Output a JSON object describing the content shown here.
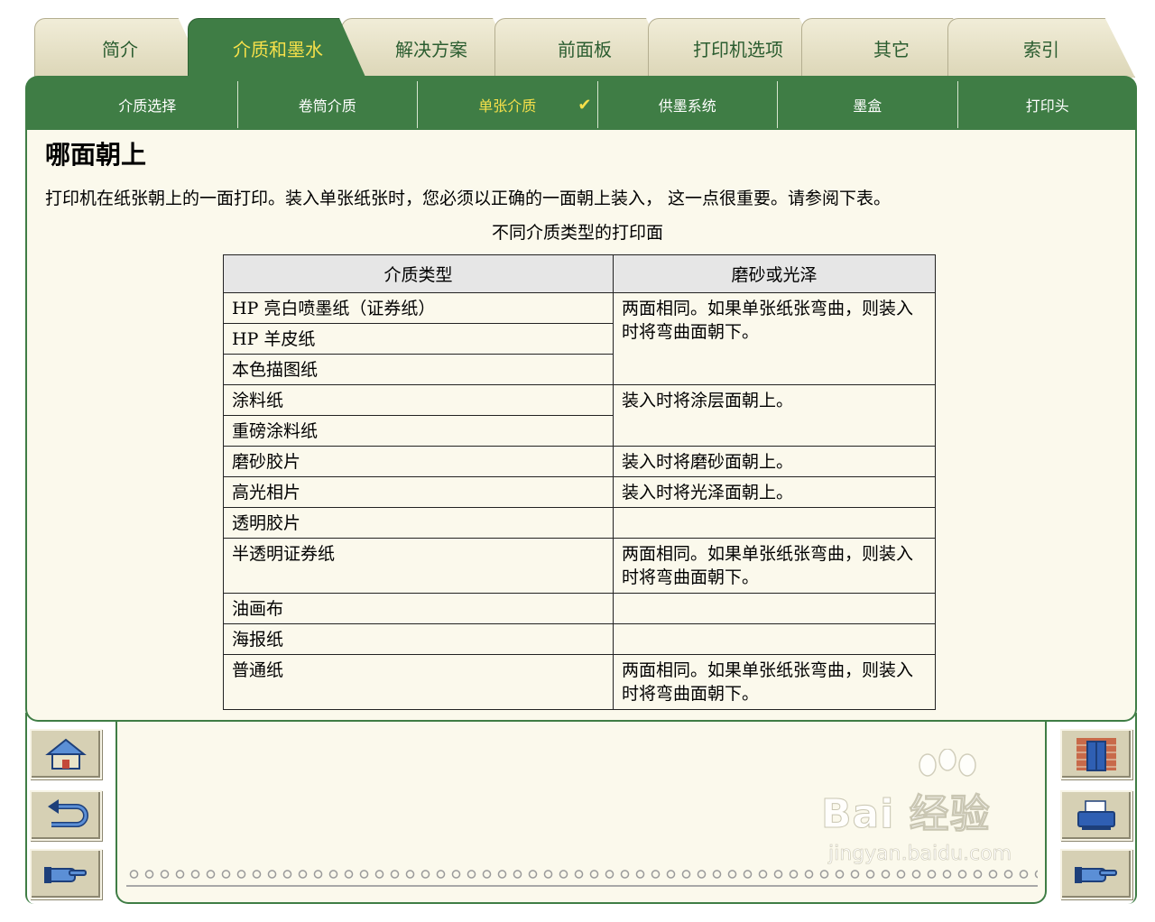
{
  "top_tabs": [
    {
      "label": "简介",
      "active": false
    },
    {
      "label": "介质和墨水",
      "active": true
    },
    {
      "label": "解决方案",
      "active": false
    },
    {
      "label": "前面板",
      "active": false
    },
    {
      "label": "打印机选项",
      "active": false
    },
    {
      "label": "其它",
      "active": false
    },
    {
      "label": "索引",
      "active": false
    }
  ],
  "sub_nav": [
    {
      "label": "介质选择",
      "active": false
    },
    {
      "label": "卷筒介质",
      "active": false
    },
    {
      "label": "单张介质",
      "active": true,
      "mark": "✔"
    },
    {
      "label": "供墨系统",
      "active": false
    },
    {
      "label": "墨盒",
      "active": false
    },
    {
      "label": "打印头",
      "active": false
    }
  ],
  "page": {
    "title": "哪面朝上",
    "intro": "打印机在纸张朝上的一面打印。装入单张纸张时，您必须以正确的一面朝上装入，  这一点很重要。请参阅下表。",
    "table_caption": "不同介质类型的打印面"
  },
  "table": {
    "headers": [
      "介质类型",
      "磨砂或光泽"
    ],
    "rows": [
      {
        "media": "HP 亮白喷墨纸（证券纸）",
        "side": "两面相同。如果单张纸张弯曲，则装入时将弯曲面朝下。",
        "span": 3
      },
      {
        "media": "HP 羊皮纸"
      },
      {
        "media": "本色描图纸"
      },
      {
        "media": "涂料纸",
        "side": "装入时将涂层面朝上。",
        "span": 2
      },
      {
        "media": "重磅涂料纸"
      },
      {
        "media": "磨砂胶片",
        "side": "装入时将磨砂面朝上。",
        "span": 1
      },
      {
        "media": "高光相片",
        "side": "装入时将光泽面朝上。",
        "span": 1
      },
      {
        "media": "透明胶片",
        "side": "",
        "span": 1
      },
      {
        "media": "半透明证券纸",
        "side": "两面相同。如果单张纸张弯曲，则装入时将弯曲面朝下。",
        "span": 1
      },
      {
        "media": "油画布",
        "side": "",
        "span": 1
      },
      {
        "media": "海报纸",
        "side": "",
        "span": 1
      },
      {
        "media": "普通纸",
        "side": "两面相同。如果单张纸张弯曲，则装入时将弯曲面朝下。",
        "span": 1
      }
    ]
  },
  "nav_buttons": {
    "left": [
      "home-icon",
      "back-icon",
      "next-hand-icon"
    ],
    "right": [
      "brick-door-icon",
      "printer-icon",
      "pointing-hand-icon"
    ]
  },
  "watermark": {
    "brand": "Bai 经验",
    "url": "jingyan.baidu.com"
  },
  "colors": {
    "accent_green": "#3f7d45",
    "active_text": "#f5e04a",
    "panel_bg": "#fbf9ec",
    "tab_bg": "#e8e3c8"
  }
}
